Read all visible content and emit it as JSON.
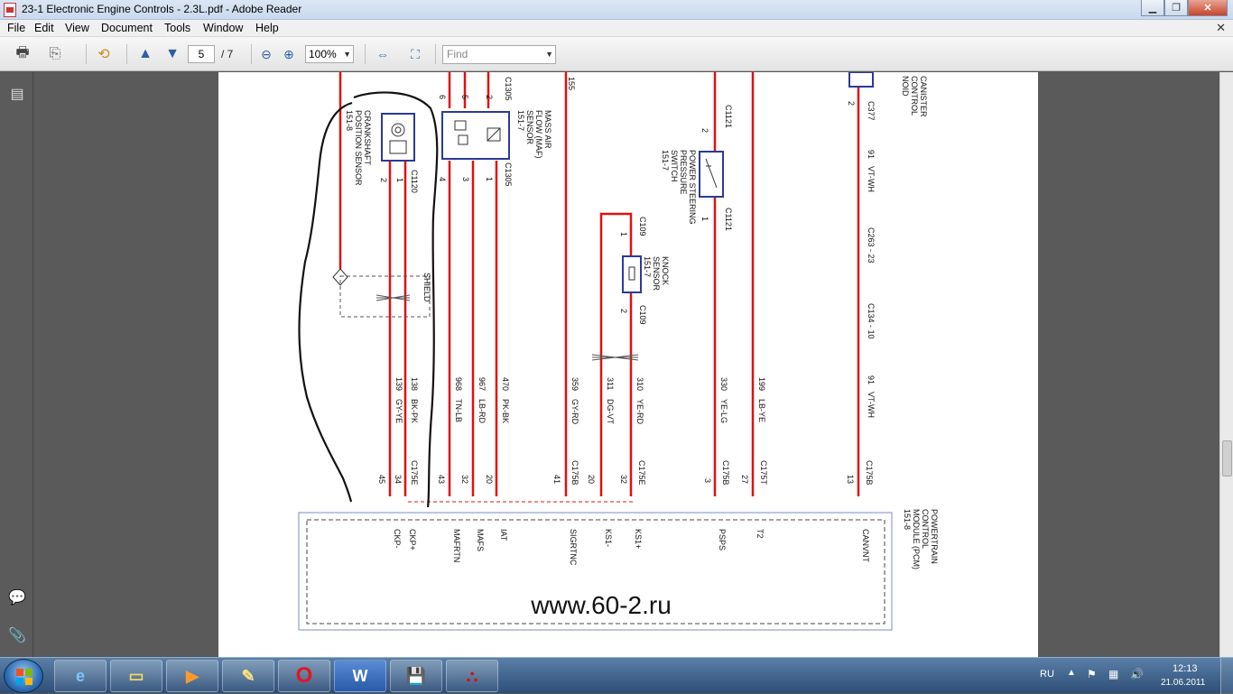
{
  "window": {
    "title": "23-1 Electronic Engine Controls - 2.3L.pdf - Adobe Reader"
  },
  "menu": [
    "File",
    "Edit",
    "View",
    "Document",
    "Tools",
    "Window",
    "Help"
  ],
  "toolbar": {
    "page_current": "5",
    "page_total": "/ 7",
    "zoom": "100%",
    "find_placeholder": "Find"
  },
  "diagram": {
    "top_connectors": [
      "6",
      "5",
      "2",
      "C1305",
      "155"
    ],
    "crankshaft": {
      "label1": "CRANKSHAFT",
      "label2": "POSITION SENSOR",
      "label3": "151-8",
      "conn": "C1120",
      "pin2": "2",
      "pin1": "1",
      "shield": "SHIELD"
    },
    "maf": {
      "label1": "MASS AIR",
      "label2": "FLOW (MAF)",
      "label3": "SENSOR",
      "label4": "151-7",
      "conn": "C1305",
      "pins": [
        "4",
        "3",
        "1"
      ]
    },
    "knock": {
      "label1": "KNOCK",
      "label2": "SENSOR",
      "label3": "151-7",
      "conn_top": "C109",
      "conn_bot": "C109",
      "pin1": "1",
      "pin2": "2"
    },
    "psps": {
      "label1": "POWER STEERING",
      "label2": "PRESSURE",
      "label3": "SWITCH",
      "label4": "151-7",
      "conn_top": "C1121",
      "conn_bot": "C1121",
      "pin2": "2",
      "pin1": "1"
    },
    "canister": {
      "label1": "CANISTER",
      "label2": "CONTROL",
      "label3": "NOID",
      "conn": "C377",
      "pin": "2",
      "wire": "91",
      "color": "VT-WH",
      "splice1": "C263 - 23",
      "splice2": "C134 - 10",
      "wire2": "91",
      "color2": "VT-WH"
    },
    "wires": [
      {
        "num": "139",
        "color": "GY-YE",
        "pin": "45",
        "sig": "CKP-"
      },
      {
        "num": "138",
        "color": "BK-PK",
        "pin": "34",
        "sig": "CKP+"
      },
      {
        "num": "968",
        "color": "TN-LB",
        "pin": "43",
        "sig": "MAFRTN"
      },
      {
        "num": "967",
        "color": "LB-RD",
        "pin": "32",
        "sig": "MAFS"
      },
      {
        "num": "470",
        "color": "PK-BK",
        "pin": "20",
        "sig": "IAT"
      },
      {
        "num": "359",
        "color": "GY-RD",
        "pin": "41",
        "sig": "SIGRTNC"
      },
      {
        "num": "311",
        "color": "DG-VT",
        "pin": "20",
        "sig": "KS1-"
      },
      {
        "num": "310",
        "color": "YE-RD",
        "pin": "32",
        "sig": "KS1+"
      },
      {
        "num": "330",
        "color": "YE-LG",
        "pin": "3",
        "sig": "PSPS"
      },
      {
        "num": "199",
        "color": "LB-YE",
        "pin": "27",
        "sig": "T2"
      },
      {
        "num": "",
        "color": "",
        "pin": "13",
        "sig": "CANVNT"
      }
    ],
    "pcm_connectors": [
      "C175E",
      "C175B",
      "C175E",
      "C175B",
      "C175T",
      "C175B"
    ],
    "pcm": {
      "label1": "POWERTRAIN",
      "label2": "CONTROL",
      "label3": "MODULE (PCM)",
      "label4": "151-8"
    },
    "watermark": "www.60-2.ru",
    "wire_color": "#e01010"
  },
  "tray": {
    "lang": "RU",
    "time": "12:13",
    "date": "21.06.2011"
  },
  "taskbar_apps": [
    "internet-explorer",
    "file-explorer",
    "media-player",
    "paint",
    "opera",
    "word",
    "save-app",
    "adobe-reader"
  ]
}
